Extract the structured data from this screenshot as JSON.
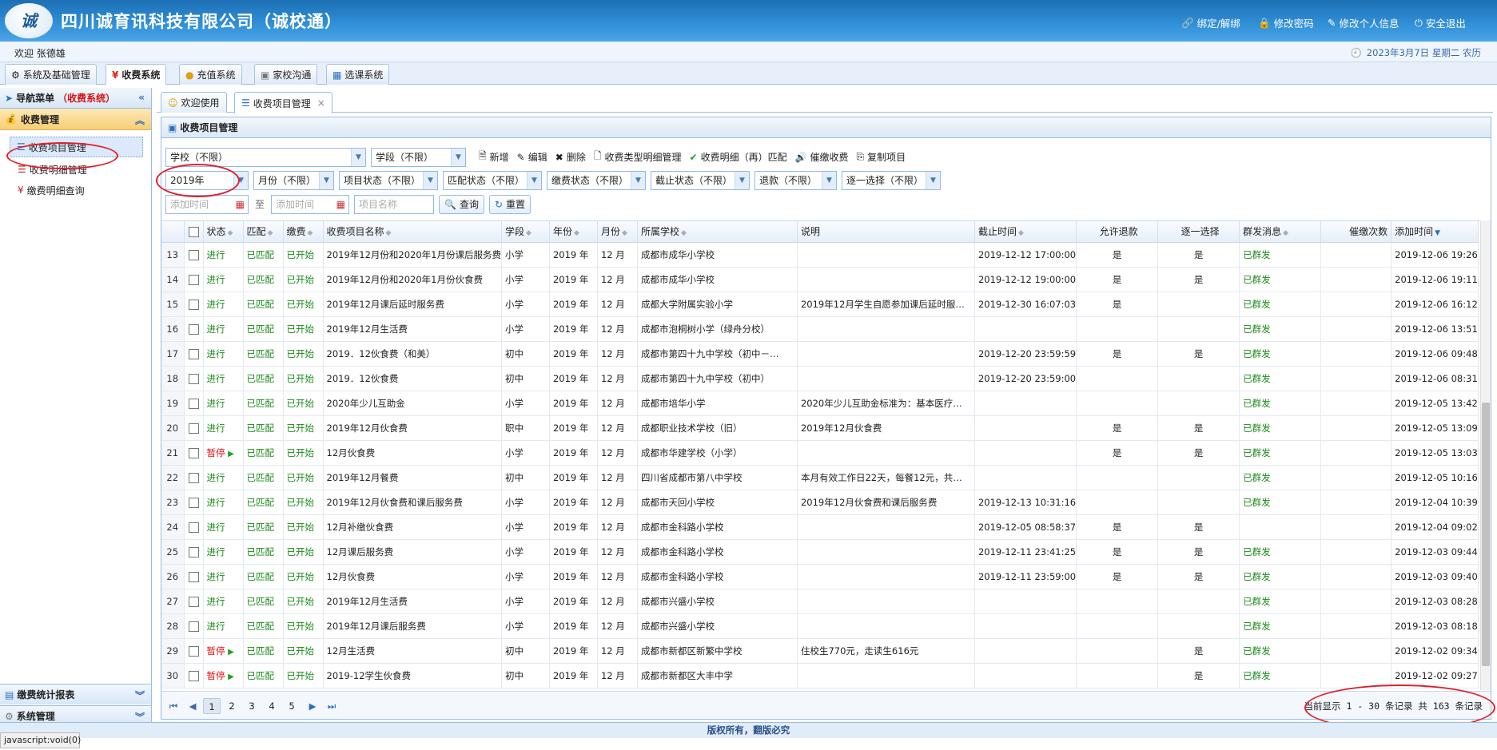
{
  "header": {
    "logo_text": "诚",
    "title": "四川诚育讯科技有限公司（诚校通）",
    "links": [
      "绑定/解绑",
      "修改密码",
      "修改个人信息",
      "安全退出"
    ]
  },
  "welcome": "欢迎 张德雄",
  "date": "2023年3月7日 星期二 农历",
  "sys_tabs": [
    "系统及基础管理",
    "收费系统",
    "充值系统",
    "家校沟通",
    "选课系统"
  ],
  "nav": {
    "title": "导航菜单",
    "title_sub": "（收费系统）",
    "group": "收费管理",
    "items": [
      "收费项目管理",
      "收费明细管理",
      "缴费明细查询"
    ],
    "bottom": [
      "缴费统计报表",
      "系统管理"
    ]
  },
  "main_tabs": [
    "欢迎使用",
    "收费项目管理"
  ],
  "panel_title": "收费项目管理",
  "filters": {
    "row1": [
      "学校（不限）",
      "学段（不限）"
    ],
    "buttons": [
      "新增",
      "编辑",
      "删除",
      "收费类型明细管理",
      "收费明细（再）匹配",
      "催缴收费",
      "复制项目"
    ],
    "row2": [
      "2019年",
      "月份（不限）",
      "项目状态（不限）",
      "匹配状态（不限）",
      "缴费状态（不限）",
      "截止状态（不限）",
      "退款（不限）",
      "逐一选择（不限）"
    ],
    "add_time_from": "添加时间",
    "to": "至",
    "add_time_to": "添加时间",
    "name_ph": "项目名称",
    "query": "查询",
    "reset": "重置"
  },
  "columns": [
    "状态",
    "匹配",
    "缴费",
    "收费项目名称",
    "学段",
    "年份",
    "月份",
    "所属学校",
    "说明",
    "截止时间",
    "允许退款",
    "逐一选择",
    "群发消息",
    "催缴次数",
    "添加时间"
  ],
  "rows": [
    [
      "13",
      "进行",
      "已匹配",
      "已开始",
      "2019年12月份和2020年1月份课后服务费",
      "小学",
      "2019 年",
      "12 月",
      "成都市成华小学校",
      "",
      "2019-12-12 17:00:00",
      "是",
      "是",
      "已群发",
      "",
      "2019-12-06 19:26"
    ],
    [
      "14",
      "进行",
      "已匹配",
      "已开始",
      "2019年12月份和2020年1月份伙食费",
      "小学",
      "2019 年",
      "12 月",
      "成都市成华小学校",
      "",
      "2019-12-12 19:00:00",
      "是",
      "是",
      "已群发",
      "",
      "2019-12-06 19:11"
    ],
    [
      "15",
      "进行",
      "已匹配",
      "已开始",
      "2019年12月课后延时服务费",
      "小学",
      "2019 年",
      "12 月",
      "成都大学附属实验小学",
      "2019年12月学生自愿参加课后延时服…",
      "2019-12-30 16:07:03",
      "是",
      "",
      "已群发",
      "",
      "2019-12-06 16:12"
    ],
    [
      "16",
      "进行",
      "已匹配",
      "已开始",
      "2019年12月生活费",
      "小学",
      "2019 年",
      "12 月",
      "成都市泡桐树小学（绿舟分校）",
      "",
      "",
      "",
      "",
      "已群发",
      "",
      "2019-12-06 13:51"
    ],
    [
      "17",
      "进行",
      "已匹配",
      "已开始",
      "2019．12伙食费（和美）",
      "初中",
      "2019 年",
      "12 月",
      "成都市第四十九中学校（初中－…",
      "",
      "2019-12-20 23:59:59",
      "是",
      "是",
      "已群发",
      "",
      "2019-12-06 09:48"
    ],
    [
      "18",
      "进行",
      "已匹配",
      "已开始",
      "2019．12伙食费",
      "初中",
      "2019 年",
      "12 月",
      "成都市第四十九中学校（初中）",
      "",
      "2019-12-20 23:59:00",
      "",
      "",
      "已群发",
      "",
      "2019-12-06 08:31"
    ],
    [
      "19",
      "进行",
      "已匹配",
      "已开始",
      "2020年少儿互助金",
      "小学",
      "2019 年",
      "12 月",
      "成都市培华小学",
      "2020年少儿互助金标准为：基本医疗…",
      "",
      "",
      "",
      "已群发",
      "",
      "2019-12-05 13:42"
    ],
    [
      "20",
      "进行",
      "已匹配",
      "已开始",
      "2019年12月伙食费",
      "职中",
      "2019 年",
      "12 月",
      "成都职业技术学校（旧）",
      "2019年12月伙食费",
      "",
      "是",
      "是",
      "已群发",
      "",
      "2019-12-05 13:09"
    ],
    [
      "21",
      "暂停",
      "已匹配",
      "已开始",
      "12月伙食费",
      "小学",
      "2019 年",
      "12 月",
      "成都市华建学校（小学）",
      "",
      "",
      "是",
      "是",
      "已群发",
      "",
      "2019-12-05 13:03"
    ],
    [
      "22",
      "进行",
      "已匹配",
      "已开始",
      "2019年12月餐费",
      "初中",
      "2019 年",
      "12 月",
      "四川省成都市第八中学校",
      "本月有效工作日22天，每餐12元，共…",
      "",
      "",
      "",
      "已群发",
      "",
      "2019-12-05 10:16"
    ],
    [
      "23",
      "进行",
      "已匹配",
      "已开始",
      "2019年12月伙食费和课后服务费",
      "小学",
      "2019 年",
      "12 月",
      "成都市天回小学校",
      "2019年12月伙食费和课后服务费",
      "2019-12-13 10:31:16",
      "",
      "",
      "已群发",
      "",
      "2019-12-04 10:39"
    ],
    [
      "24",
      "进行",
      "已匹配",
      "已开始",
      "12月补缴伙食费",
      "小学",
      "2019 年",
      "12 月",
      "成都市金科路小学校",
      "",
      "2019-12-05 08:58:37",
      "是",
      "是",
      "",
      "",
      "2019-12-04 09:02"
    ],
    [
      "25",
      "进行",
      "已匹配",
      "已开始",
      "12月课后服务费",
      "小学",
      "2019 年",
      "12 月",
      "成都市金科路小学校",
      "",
      "2019-12-11 23:41:25",
      "是",
      "是",
      "已群发",
      "",
      "2019-12-03 09:44"
    ],
    [
      "26",
      "进行",
      "已匹配",
      "已开始",
      "12月伙食费",
      "小学",
      "2019 年",
      "12 月",
      "成都市金科路小学校",
      "",
      "2019-12-11 23:59:00",
      "是",
      "是",
      "已群发",
      "",
      "2019-12-03 09:40"
    ],
    [
      "27",
      "进行",
      "已匹配",
      "已开始",
      "2019年12月生活费",
      "小学",
      "2019 年",
      "12 月",
      "成都市兴盛小学校",
      "",
      "",
      "",
      "",
      "已群发",
      "",
      "2019-12-03 08:28"
    ],
    [
      "28",
      "进行",
      "已匹配",
      "已开始",
      "2019年12月课后服务费",
      "小学",
      "2019 年",
      "12 月",
      "成都市兴盛小学校",
      "",
      "",
      "",
      "",
      "已群发",
      "",
      "2019-12-03 08:18"
    ],
    [
      "29",
      "暂停",
      "已匹配",
      "已开始",
      "12月生活费",
      "初中",
      "2019 年",
      "12 月",
      "成都市新都区新繁中学校",
      "住校生770元，走读生616元",
      "",
      "",
      "是",
      "已群发",
      "",
      "2019-12-02 09:34"
    ],
    [
      "30",
      "暂停",
      "已匹配",
      "已开始",
      "2019-12学生伙食费",
      "初中",
      "2019 年",
      "12 月",
      "成都市新都区大丰中学",
      "",
      "",
      "",
      "是",
      "已群发",
      "",
      "2019-12-02 09:27"
    ]
  ],
  "pager": {
    "pages": [
      "1",
      "2",
      "3",
      "4",
      "5"
    ],
    "info": "当前显示 1 - 30 条记录 共 163 条记录"
  },
  "footer": "版权所有，翻版必究",
  "status": "javascript:void(0)",
  "colors": {
    "header": "#2f8ed6",
    "accent_red": "#e0202a",
    "status_green": "#1b8a1b"
  }
}
